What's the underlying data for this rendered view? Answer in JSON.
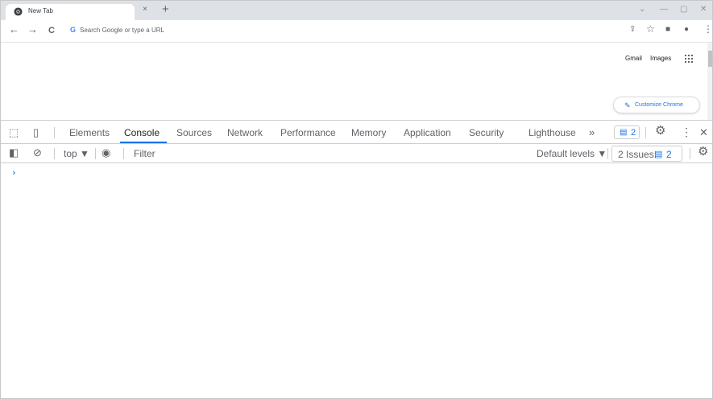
{
  "window": {
    "tab_title": "New Tab",
    "tab_close": "×",
    "new_tab": "+",
    "minimize": "—",
    "restore": "▢",
    "close": "✕",
    "tab_search": "⌄"
  },
  "toolbar": {
    "back": "←",
    "forward": "→",
    "reload": "C",
    "omnibox_g": "G",
    "omnibox_placeholder": "Search Google or type a URL",
    "share": "⇪",
    "bookmark": "☆",
    "sidepanel": "■",
    "profile": "●",
    "menu": "⋮"
  },
  "ntp": {
    "gmail": "Gmail",
    "images": "Images",
    "customize_label": "Customize Chrome",
    "customize_icon": "✎"
  },
  "devtools": {
    "inspect_icon": "⬚",
    "device_icon": "▯",
    "tabs": [
      {
        "label": "Elements"
      },
      {
        "label": "Console"
      },
      {
        "label": "Sources"
      },
      {
        "label": "Network"
      },
      {
        "label": "Performance"
      },
      {
        "label": "Memory"
      },
      {
        "label": "Application"
      },
      {
        "label": "Security"
      },
      {
        "label": "Lighthouse"
      }
    ],
    "active_tab": "Console",
    "more_tabs": "»",
    "badge_icon": "▤",
    "badge_count": "2",
    "settings_icon": "⚙",
    "menu_icon": "⋮",
    "close_icon": "✕",
    "console_toolbar": {
      "sidebar_icon": "◧",
      "clear_icon": "⊘",
      "context": "top ▼",
      "eye_icon": "◉",
      "filter_placeholder": "Filter",
      "levels": "Default levels ▼",
      "issues_label": "2 Issues:",
      "issues_icon": "▤",
      "issues_count": "2",
      "settings_icon": "⚙"
    },
    "prompt": "›"
  },
  "colors": {
    "accent": "#1a73e8",
    "tabstrip": "#dee1e6",
    "text": "#5f6368"
  }
}
